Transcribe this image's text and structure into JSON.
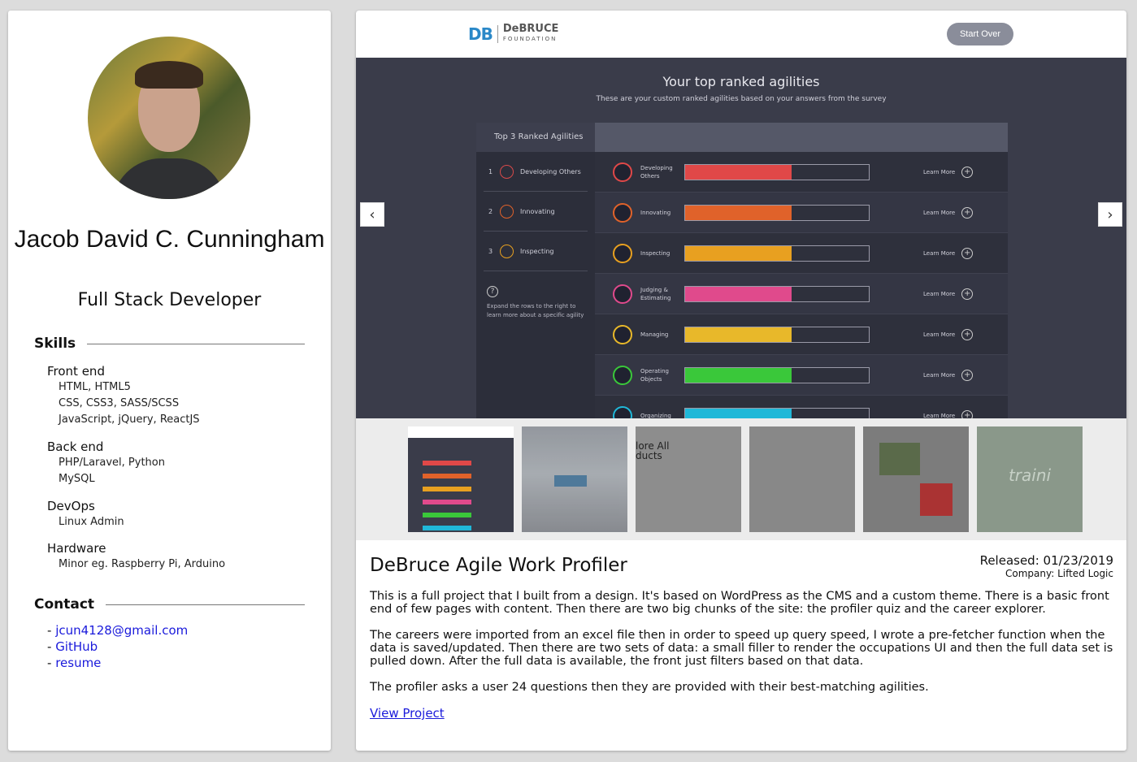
{
  "profile": {
    "name": "Jacob David C. Cunningham",
    "role": "Full Stack Developer"
  },
  "skills": {
    "heading": "Skills",
    "groups": [
      {
        "title": "Front end",
        "items": [
          "HTML, HTML5",
          "CSS, CSS3, SASS/SCSS",
          "JavaScript, jQuery, ReactJS"
        ]
      },
      {
        "title": "Back end",
        "items": [
          "PHP/Laravel, Python",
          "MySQL"
        ]
      },
      {
        "title": "DevOps",
        "items": [
          "Linux Admin"
        ]
      },
      {
        "title": "Hardware",
        "items": [
          "Minor eg. Raspberry Pi, Arduino"
        ]
      }
    ]
  },
  "contact": {
    "heading": "Contact",
    "email": "jcun4128@gmail.com",
    "github": "GitHub",
    "resume": "resume",
    "prefix": "- "
  },
  "screenshot": {
    "logo_short": "DB",
    "logo_name": "DeBRUCE",
    "logo_sub": "FOUNDATION",
    "start_over": "Start Over",
    "heading": "Your top ranked agilities",
    "subheading": "These are your custom ranked agilities based on your answers from the survey",
    "top_title": "Top 3 Ranked Agilities",
    "top_items": [
      {
        "num": "1",
        "label": "Developing Others"
      },
      {
        "num": "2",
        "label": "Innovating"
      },
      {
        "num": "3",
        "label": "Inspecting"
      }
    ],
    "help_text": "Expand the rows to the right to learn more about a specific agility",
    "learn_more": "Learn More",
    "agilities": [
      {
        "label": "Developing Others",
        "level": 0.58,
        "color": "#e04848"
      },
      {
        "label": "Innovating",
        "level": 0.58,
        "color": "#e0622a"
      },
      {
        "label": "Inspecting",
        "level": 0.58,
        "color": "#e8a020"
      },
      {
        "label": "Judging & Estimating",
        "level": 0.58,
        "color": "#e04a8c"
      },
      {
        "label": "Managing",
        "level": 0.58,
        "color": "#e8b82a"
      },
      {
        "label": "Operating Objects",
        "level": 0.58,
        "color": "#3ac83a"
      },
      {
        "label": "Organizing",
        "level": 0.58,
        "color": "#20b8d8"
      }
    ],
    "thumb3_text": "lore All\nducts",
    "thumb6_text": "traini"
  },
  "project": {
    "title": "DeBruce Agile Work Profiler",
    "released": "Released: 01/23/2019",
    "company": "Company: Lifted Logic",
    "paragraphs": [
      "This is a full project that I built from a design. It's based on WordPress as the CMS and a custom theme. There is a basic front end of few pages with content. Then there are two big chunks of the site: the profiler quiz and the career explorer.",
      "The careers were imported from an excel file then in order to speed up query speed, I wrote a pre-fetcher function when the data is saved/updated. Then there are two sets of data: a small filler to render the occupations UI and then the full data set is pulled down. After the full data is available, the front just filters based on that data.",
      "The profiler asks a user 24 questions then they are provided with their best-matching agilities."
    ],
    "view_link": "View Project"
  }
}
